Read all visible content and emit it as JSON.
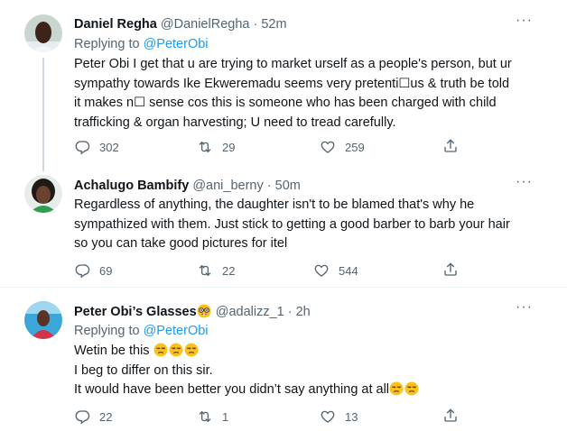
{
  "tweets": [
    {
      "name": "Daniel Regha",
      "handle": "@DanielRegha",
      "time": "52m",
      "replying_prefix": "Replying to ",
      "replying_to": "@PeterObi",
      "lines": [
        "Peter Obi I get that u are trying to market urself as a people's person, but ur",
        "sympathy towards Ike Ekweremadu seems very pretenti☐us & truth be told",
        "it makes n☐ sense cos this is someone who has been charged with child",
        "trafficking & organ harvesting; U need to tread carefully."
      ],
      "replies": "302",
      "retweets": "29",
      "likes": "259"
    },
    {
      "name": "Achalugo Bambify",
      "handle": "@ani_berny",
      "time": "50m",
      "lines": [
        "Regardless of anything, the daughter isn't to be blamed that's why he",
        "sympathized with them. Just stick to getting a good barber to barb your hair",
        "so you can take good pictures for itel"
      ],
      "replies": "69",
      "retweets": "22",
      "likes": "544"
    },
    {
      "name": "Peter Obi’s Glasses",
      "name_emoji": "nerd-face-emoji",
      "handle": "@adalizz_1",
      "time": "2h",
      "replying_prefix": "Replying to ",
      "replying_to": "@PeterObi",
      "lines": [
        "Wetin be this",
        "I beg to differ on this sir.",
        "It would have been better you didn’t say anything at all"
      ],
      "line_emojis": [
        "unamused-face-emoji",
        "unamused-face-emoji"
      ],
      "replies": "22",
      "retweets": "1",
      "likes": "13"
    }
  ],
  "separators": "·",
  "colors": {
    "accent": "#1d9bf0",
    "secondary": "#536471",
    "text": "#0f1419",
    "divider": "#eff3f4",
    "thread": "#cfd9de"
  },
  "icons": [
    "reply-icon",
    "retweet-icon",
    "like-icon",
    "share-icon",
    "more-icon"
  ]
}
